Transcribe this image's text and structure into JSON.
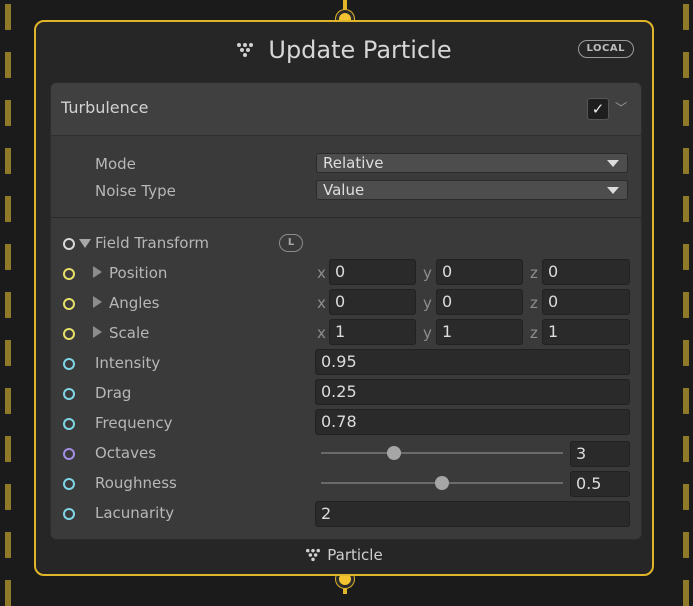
{
  "node": {
    "title": "Update Particle",
    "space_badge": "LOCAL",
    "footer_label": "Particle",
    "icon": "vfx-particle-icon"
  },
  "block": {
    "title": "Turbulence",
    "enabled": true,
    "mode_label": "Mode",
    "mode_value": "Relative",
    "noise_type_label": "Noise Type",
    "noise_type_value": "Value",
    "field_transform_label": "Field Transform",
    "field_transform_space": "L",
    "position": {
      "label": "Position",
      "x": "0",
      "y": "0",
      "z": "0"
    },
    "angles": {
      "label": "Angles",
      "x": "0",
      "y": "0",
      "z": "0"
    },
    "scale": {
      "label": "Scale",
      "x": "1",
      "y": "1",
      "z": "1"
    },
    "axis_labels": {
      "x": "x",
      "y": "y",
      "z": "z"
    },
    "intensity": {
      "label": "Intensity",
      "value": "0.95"
    },
    "drag": {
      "label": "Drag",
      "value": "0.25"
    },
    "frequency": {
      "label": "Frequency",
      "value": "0.78"
    },
    "octaves": {
      "label": "Octaves",
      "value": "3",
      "slider_fraction": 0.3
    },
    "roughness": {
      "label": "Roughness",
      "value": "0.5",
      "slider_fraction": 0.5
    },
    "lacunarity": {
      "label": "Lacunarity",
      "value": "2"
    }
  },
  "colors": {
    "flow_accent": "#e1b52a",
    "port_vector": "#e6e06a",
    "port_float": "#7fd6e6",
    "port_int": "#a58ee6"
  }
}
